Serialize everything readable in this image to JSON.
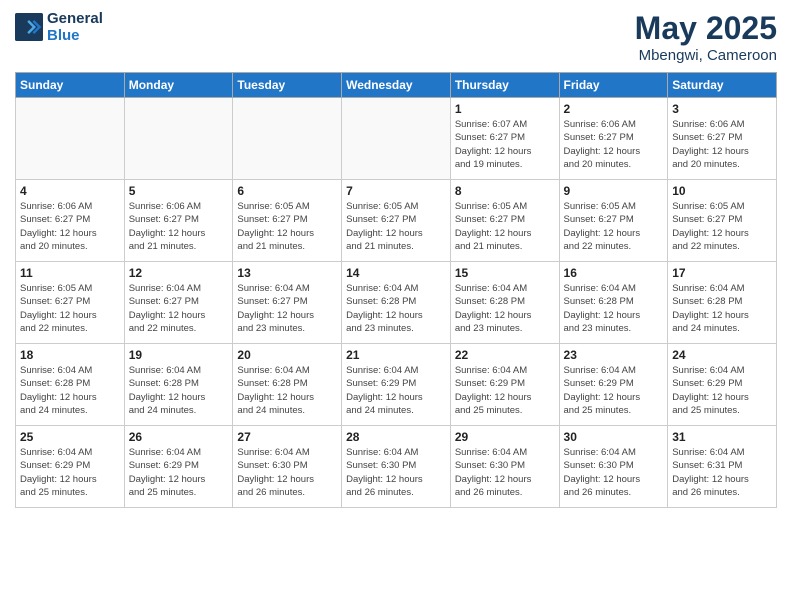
{
  "header": {
    "logo_line1": "General",
    "logo_line2": "Blue",
    "month": "May 2025",
    "location": "Mbengwi, Cameroon"
  },
  "weekdays": [
    "Sunday",
    "Monday",
    "Tuesday",
    "Wednesday",
    "Thursday",
    "Friday",
    "Saturday"
  ],
  "days": [
    {
      "day": "",
      "info": ""
    },
    {
      "day": "",
      "info": ""
    },
    {
      "day": "",
      "info": ""
    },
    {
      "day": "",
      "info": ""
    },
    {
      "day": "1",
      "info": "Sunrise: 6:07 AM\nSunset: 6:27 PM\nDaylight: 12 hours\nand 19 minutes."
    },
    {
      "day": "2",
      "info": "Sunrise: 6:06 AM\nSunset: 6:27 PM\nDaylight: 12 hours\nand 20 minutes."
    },
    {
      "day": "3",
      "info": "Sunrise: 6:06 AM\nSunset: 6:27 PM\nDaylight: 12 hours\nand 20 minutes."
    },
    {
      "day": "4",
      "info": "Sunrise: 6:06 AM\nSunset: 6:27 PM\nDaylight: 12 hours\nand 20 minutes."
    },
    {
      "day": "5",
      "info": "Sunrise: 6:06 AM\nSunset: 6:27 PM\nDaylight: 12 hours\nand 21 minutes."
    },
    {
      "day": "6",
      "info": "Sunrise: 6:05 AM\nSunset: 6:27 PM\nDaylight: 12 hours\nand 21 minutes."
    },
    {
      "day": "7",
      "info": "Sunrise: 6:05 AM\nSunset: 6:27 PM\nDaylight: 12 hours\nand 21 minutes."
    },
    {
      "day": "8",
      "info": "Sunrise: 6:05 AM\nSunset: 6:27 PM\nDaylight: 12 hours\nand 21 minutes."
    },
    {
      "day": "9",
      "info": "Sunrise: 6:05 AM\nSunset: 6:27 PM\nDaylight: 12 hours\nand 22 minutes."
    },
    {
      "day": "10",
      "info": "Sunrise: 6:05 AM\nSunset: 6:27 PM\nDaylight: 12 hours\nand 22 minutes."
    },
    {
      "day": "11",
      "info": "Sunrise: 6:05 AM\nSunset: 6:27 PM\nDaylight: 12 hours\nand 22 minutes."
    },
    {
      "day": "12",
      "info": "Sunrise: 6:04 AM\nSunset: 6:27 PM\nDaylight: 12 hours\nand 22 minutes."
    },
    {
      "day": "13",
      "info": "Sunrise: 6:04 AM\nSunset: 6:27 PM\nDaylight: 12 hours\nand 23 minutes."
    },
    {
      "day": "14",
      "info": "Sunrise: 6:04 AM\nSunset: 6:28 PM\nDaylight: 12 hours\nand 23 minutes."
    },
    {
      "day": "15",
      "info": "Sunrise: 6:04 AM\nSunset: 6:28 PM\nDaylight: 12 hours\nand 23 minutes."
    },
    {
      "day": "16",
      "info": "Sunrise: 6:04 AM\nSunset: 6:28 PM\nDaylight: 12 hours\nand 23 minutes."
    },
    {
      "day": "17",
      "info": "Sunrise: 6:04 AM\nSunset: 6:28 PM\nDaylight: 12 hours\nand 24 minutes."
    },
    {
      "day": "18",
      "info": "Sunrise: 6:04 AM\nSunset: 6:28 PM\nDaylight: 12 hours\nand 24 minutes."
    },
    {
      "day": "19",
      "info": "Sunrise: 6:04 AM\nSunset: 6:28 PM\nDaylight: 12 hours\nand 24 minutes."
    },
    {
      "day": "20",
      "info": "Sunrise: 6:04 AM\nSunset: 6:28 PM\nDaylight: 12 hours\nand 24 minutes."
    },
    {
      "day": "21",
      "info": "Sunrise: 6:04 AM\nSunset: 6:29 PM\nDaylight: 12 hours\nand 24 minutes."
    },
    {
      "day": "22",
      "info": "Sunrise: 6:04 AM\nSunset: 6:29 PM\nDaylight: 12 hours\nand 25 minutes."
    },
    {
      "day": "23",
      "info": "Sunrise: 6:04 AM\nSunset: 6:29 PM\nDaylight: 12 hours\nand 25 minutes."
    },
    {
      "day": "24",
      "info": "Sunrise: 6:04 AM\nSunset: 6:29 PM\nDaylight: 12 hours\nand 25 minutes."
    },
    {
      "day": "25",
      "info": "Sunrise: 6:04 AM\nSunset: 6:29 PM\nDaylight: 12 hours\nand 25 minutes."
    },
    {
      "day": "26",
      "info": "Sunrise: 6:04 AM\nSunset: 6:29 PM\nDaylight: 12 hours\nand 25 minutes."
    },
    {
      "day": "27",
      "info": "Sunrise: 6:04 AM\nSunset: 6:30 PM\nDaylight: 12 hours\nand 26 minutes."
    },
    {
      "day": "28",
      "info": "Sunrise: 6:04 AM\nSunset: 6:30 PM\nDaylight: 12 hours\nand 26 minutes."
    },
    {
      "day": "29",
      "info": "Sunrise: 6:04 AM\nSunset: 6:30 PM\nDaylight: 12 hours\nand 26 minutes."
    },
    {
      "day": "30",
      "info": "Sunrise: 6:04 AM\nSunset: 6:30 PM\nDaylight: 12 hours\nand 26 minutes."
    },
    {
      "day": "31",
      "info": "Sunrise: 6:04 AM\nSunset: 6:31 PM\nDaylight: 12 hours\nand 26 minutes."
    },
    {
      "day": "",
      "info": ""
    },
    {
      "day": "",
      "info": ""
    },
    {
      "day": "",
      "info": ""
    },
    {
      "day": "",
      "info": ""
    }
  ]
}
